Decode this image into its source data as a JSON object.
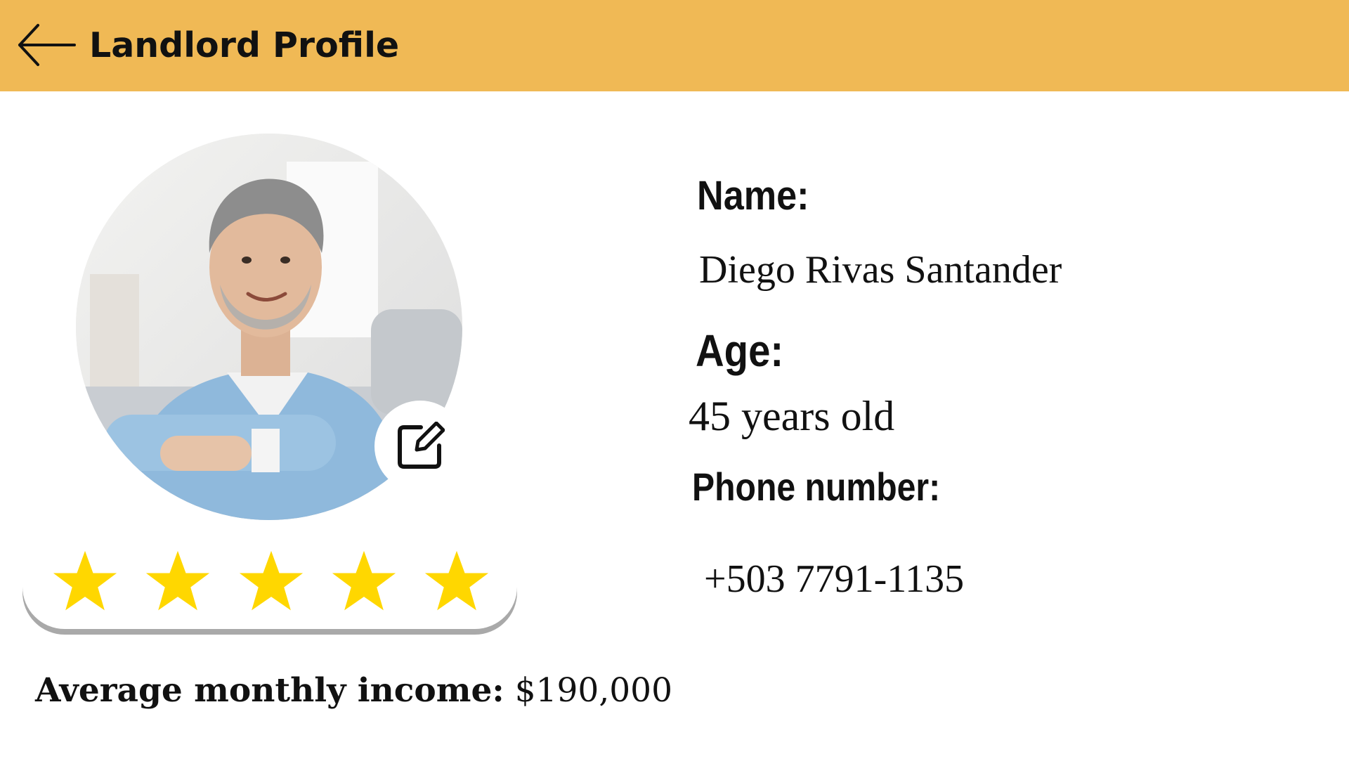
{
  "header": {
    "title": "Landlord Profile",
    "back_icon": "arrow-left-icon",
    "background_color": "#F0B955"
  },
  "profile": {
    "avatar_description_icon": "avatar",
    "edit_icon": "edit-icon",
    "rating": 5,
    "rating_max": 5,
    "star_color": "#FFD700",
    "income_label": "Average monthly income:",
    "income_value": "$190,000"
  },
  "details": {
    "name_label": "Name:",
    "name_value": "Diego Rivas Santander",
    "age_label": "Age:",
    "age_value": "45 years old",
    "phone_label": "Phone number:",
    "phone_value": "+503 7791-1135"
  }
}
